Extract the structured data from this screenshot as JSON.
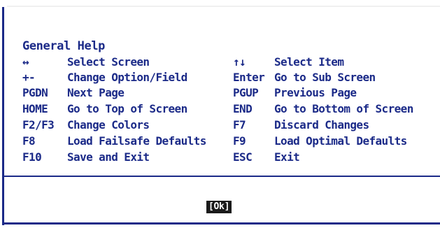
{
  "dialog": {
    "title": "General Help",
    "ok_label": "[Ok]"
  },
  "help": {
    "rows": [
      {
        "key1": "↔",
        "desc1": "Select Screen",
        "key2": "↑↓",
        "desc2": "Select Item"
      },
      {
        "key1": "+-",
        "desc1": "Change Option/Field",
        "key2": "Enter",
        "desc2": "Go to Sub Screen"
      },
      {
        "key1": "PGDN",
        "desc1": "Next Page",
        "key2": "PGUP",
        "desc2": "Previous Page"
      },
      {
        "key1": "HOME",
        "desc1": "Go to Top of Screen",
        "key2": "END",
        "desc2": "Go to Bottom of Screen"
      },
      {
        "key1": "F2/F3",
        "desc1": "Change Colors",
        "key2": "F7",
        "desc2": "Discard Changes"
      },
      {
        "key1": "F8",
        "desc1": "Load Failsafe Defaults",
        "key2": "F9",
        "desc2": "Load Optimal Defaults"
      },
      {
        "key1": "F10",
        "desc1": "Save and Exit",
        "key2": "ESC",
        "desc2": "Exit"
      }
    ]
  },
  "colors": {
    "text": "#1b2a88",
    "border": "#1b2a88",
    "background": "#ffffff",
    "button_bg": "#1b1b1b",
    "button_text": "#ffffff"
  }
}
